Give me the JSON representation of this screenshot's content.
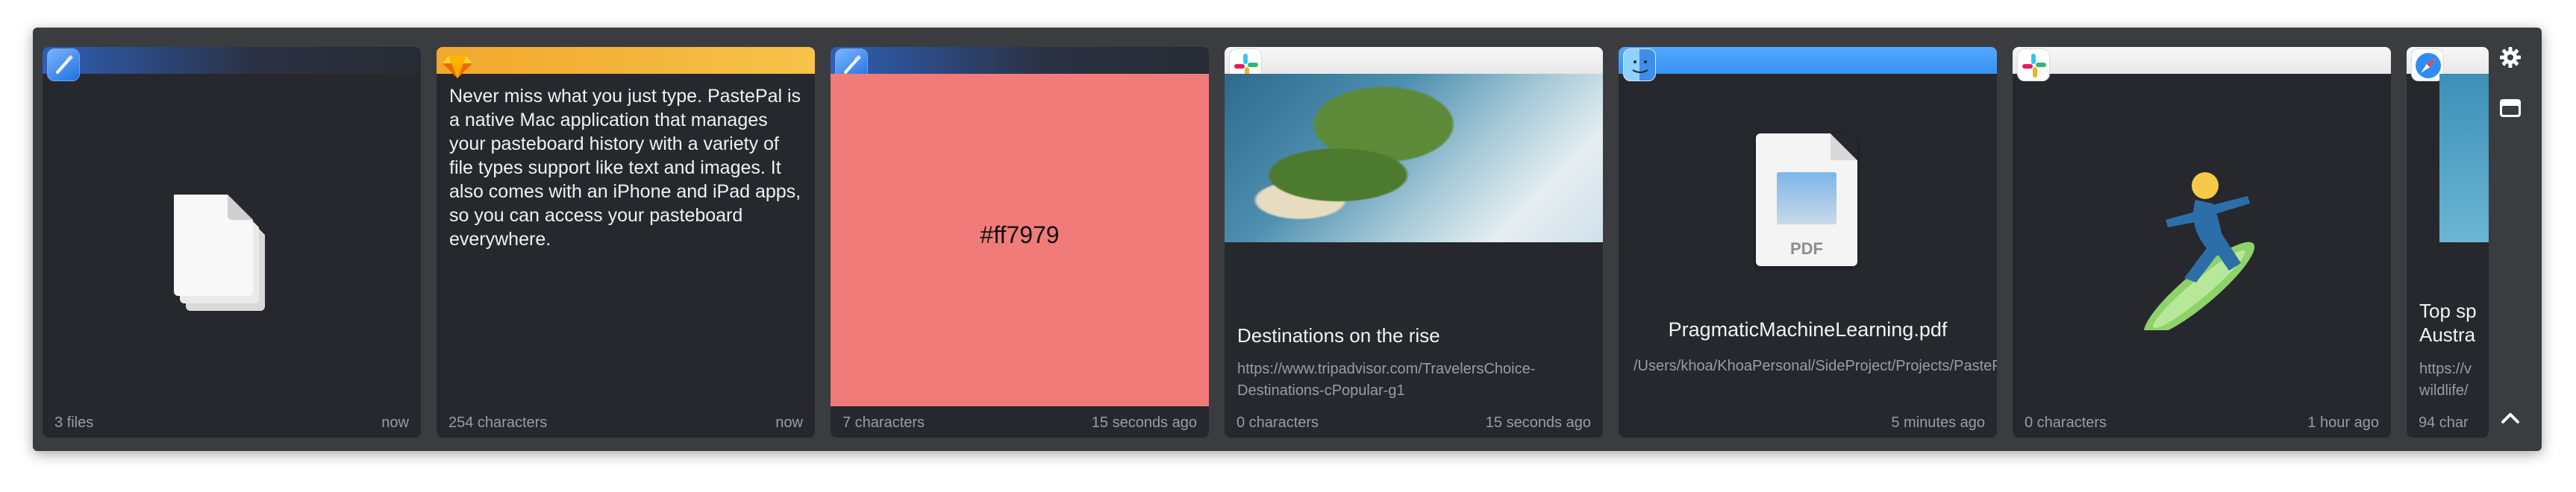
{
  "cards": [
    {
      "app": "xcode-icon",
      "footer_left": "3 files",
      "footer_right": "now"
    },
    {
      "app": "sketch-icon",
      "text": "Never miss what you just type. PastePal is a native Mac application that manages your pasteboard history with a variety of file types support like text and images. It also comes with an iPhone and iPad apps, so you can access your pasteboard everywhere.",
      "footer_left": "254 characters",
      "footer_right": "now"
    },
    {
      "app": "xcode-icon",
      "color_value": "#ff7979",
      "footer_left": "7 characters",
      "footer_right": "15 seconds ago"
    },
    {
      "app": "slack-icon",
      "title": "Destinations on the rise",
      "url": "https://www.tripadvisor.com/TravelersChoice-Destinations-cPopular-g1",
      "footer_left": "0 characters",
      "footer_right": "15 seconds ago"
    },
    {
      "app": "finder-icon",
      "pdf_label": "PDF",
      "filename": "PragmaticMachineLearning.pdf",
      "path": "/Users/khoa/KhoaPersonal/SideProject/Projects/PastePal/demo/PragmaticMachineLearning.pdf",
      "footer_left": "",
      "footer_right": "5 minutes ago"
    },
    {
      "app": "slack-icon",
      "emoji": "🏄‍♂️",
      "footer_left": "0 characters",
      "footer_right": "1 hour ago"
    },
    {
      "app": "safari-icon",
      "title": "Top sp Austra",
      "url": "https://v wildlife/",
      "footer_left": "94 char"
    }
  ],
  "sidebar": {
    "settings_icon": "gear-icon",
    "toggle_icon": "panel-icon",
    "collapse_icon": "chevron-up-icon"
  },
  "colors": {
    "panel_bg": "#3b3c40",
    "card_bg": "#26282d",
    "swatch": "#f07b79"
  }
}
